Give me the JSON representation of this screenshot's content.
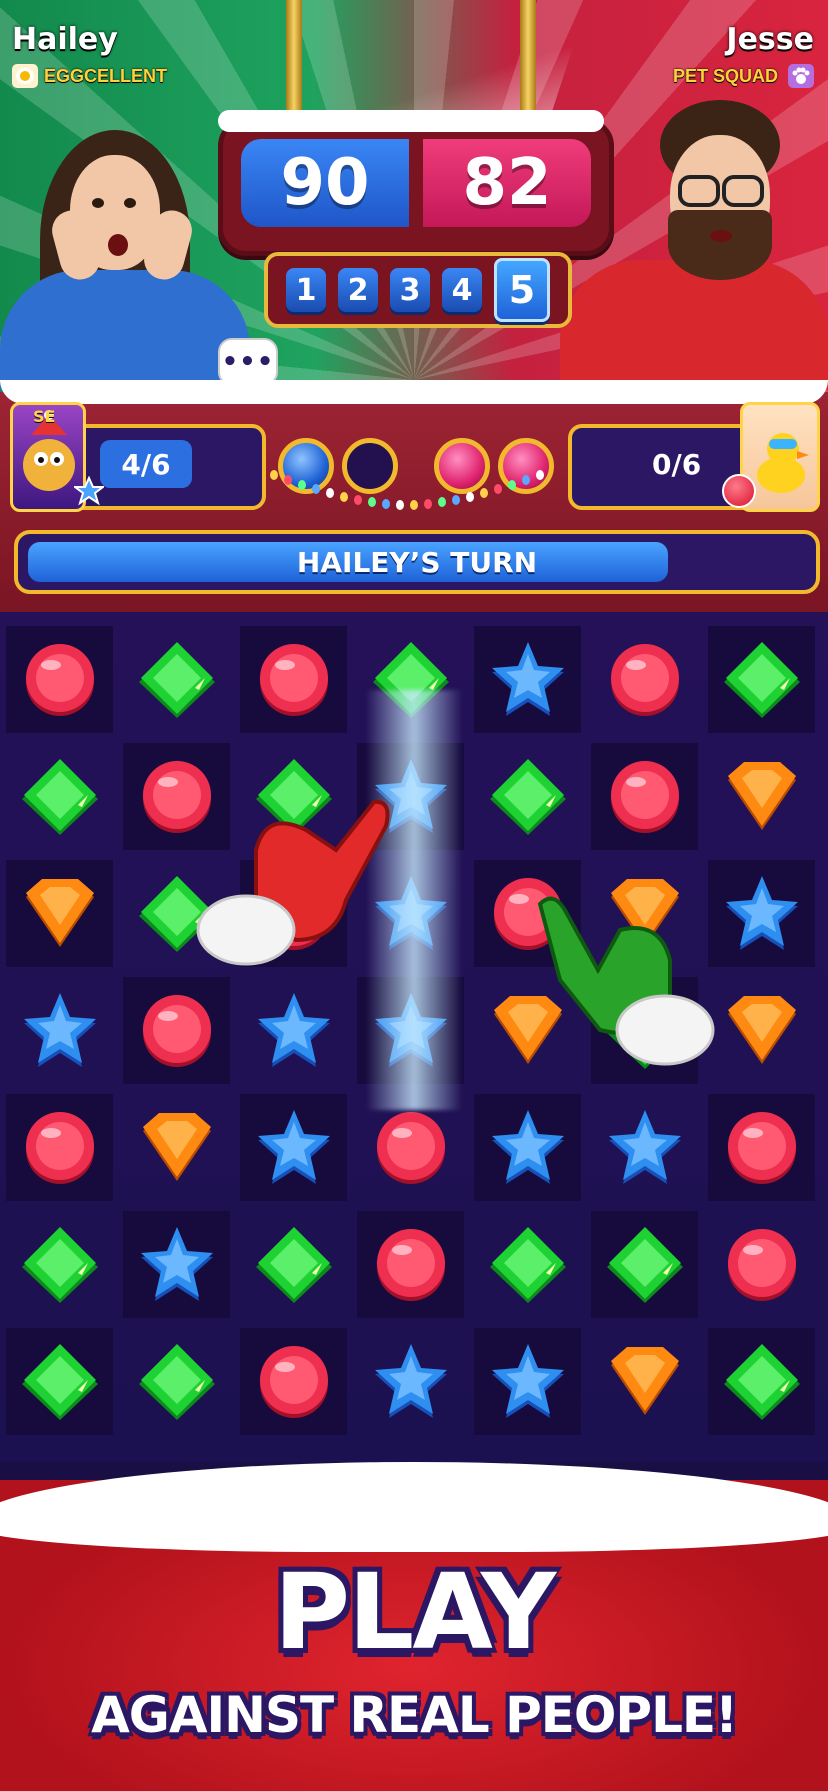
{
  "players": {
    "left": {
      "name": "Hailey",
      "team": "EGGCELLENT",
      "cards_progress": "4/6"
    },
    "right": {
      "name": "Jesse",
      "team": "PET SQUAD",
      "cards_progress": "0/6"
    }
  },
  "scoreboard": {
    "left_score": "90",
    "right_score": "82",
    "rounds": [
      "1",
      "2",
      "3",
      "4",
      "5"
    ],
    "current_round": "5"
  },
  "card_badge": "SE",
  "chat_bubble": "•••",
  "turn": {
    "label": "HAILEY’S TURN",
    "timer_fraction": 0.82
  },
  "orbs": [
    "blue",
    "empty",
    "pink",
    "pink"
  ],
  "board": {
    "rows": 7,
    "cols": 7,
    "grid": [
      [
        "red",
        "green",
        "red",
        "green",
        "blue",
        "red",
        "green"
      ],
      [
        "green",
        "red",
        "green",
        "blue",
        "green",
        "red",
        "orange"
      ],
      [
        "orange",
        "green",
        "red",
        "blue",
        "red",
        "orange",
        "blue"
      ],
      [
        "blue",
        "red",
        "blue",
        "blue",
        "orange",
        "green",
        "orange"
      ],
      [
        "red",
        "orange",
        "blue",
        "red",
        "blue",
        "blue",
        "red"
      ],
      [
        "green",
        "blue",
        "green",
        "red",
        "green",
        "green",
        "red"
      ],
      [
        "green",
        "green",
        "red",
        "blue",
        "blue",
        "orange",
        "green"
      ]
    ]
  },
  "colors": {
    "red": "#ef2f4f",
    "green": "#1fd233",
    "blue": "#2f8ff0",
    "orange": "#ff8a12",
    "gold": "#f2b92d",
    "panel": "#2b1763"
  },
  "icons": {
    "left_team": "egg-icon",
    "right_team": "paw-icon",
    "left_card": "monster-card-icon",
    "right_card": "duck-card-icon"
  },
  "cta": {
    "main": "PLAY",
    "sub": "AGAINST REAL PEOPLE!"
  }
}
